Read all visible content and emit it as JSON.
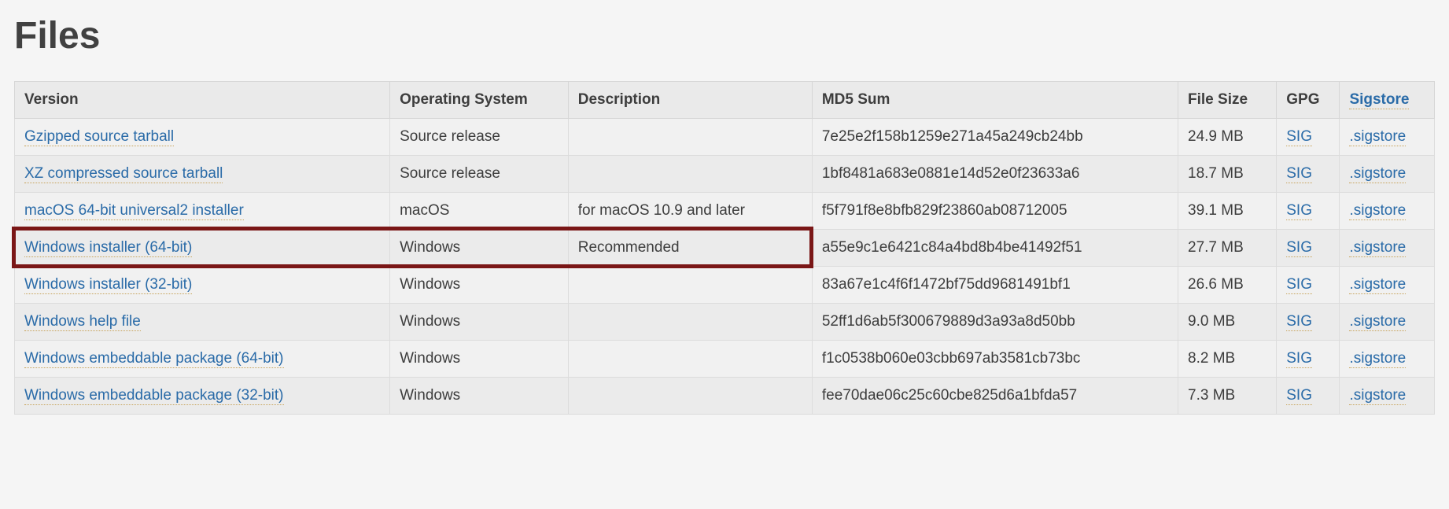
{
  "title": "Files",
  "headers": {
    "version": "Version",
    "os": "Operating System",
    "description": "Description",
    "md5": "MD5 Sum",
    "size": "File Size",
    "gpg": "GPG",
    "sigstore": "Sigstore"
  },
  "rows": [
    {
      "version": "Gzipped source tarball",
      "os": "Source release",
      "description": "",
      "md5": "7e25e2f158b1259e271a45a249cb24bb",
      "size": "24.9 MB",
      "gpg": "SIG",
      "sigstore": ".sigstore",
      "highlight": false
    },
    {
      "version": "XZ compressed source tarball",
      "os": "Source release",
      "description": "",
      "md5": "1bf8481a683e0881e14d52e0f23633a6",
      "size": "18.7 MB",
      "gpg": "SIG",
      "sigstore": ".sigstore",
      "highlight": false
    },
    {
      "version": "macOS 64-bit universal2 installer",
      "os": "macOS",
      "description": "for macOS 10.9 and later",
      "md5": "f5f791f8e8bfb829f23860ab08712005",
      "size": "39.1 MB",
      "gpg": "SIG",
      "sigstore": ".sigstore",
      "highlight": false
    },
    {
      "version": "Windows installer (64-bit)",
      "os": "Windows",
      "description": "Recommended",
      "md5": "a55e9c1e6421c84a4bd8b4be41492f51",
      "size": "27.7 MB",
      "gpg": "SIG",
      "sigstore": ".sigstore",
      "highlight": true
    },
    {
      "version": "Windows installer (32-bit)",
      "os": "Windows",
      "description": "",
      "md5": "83a67e1c4f6f1472bf75dd9681491bf1",
      "size": "26.6 MB",
      "gpg": "SIG",
      "sigstore": ".sigstore",
      "highlight": false
    },
    {
      "version": "Windows help file",
      "os": "Windows",
      "description": "",
      "md5": "52ff1d6ab5f300679889d3a93a8d50bb",
      "size": "9.0 MB",
      "gpg": "SIG",
      "sigstore": ".sigstore",
      "highlight": false
    },
    {
      "version": "Windows embeddable package (64-bit)",
      "os": "Windows",
      "description": "",
      "md5": "f1c0538b060e03cbb697ab3581cb73bc",
      "size": "8.2 MB",
      "gpg": "SIG",
      "sigstore": ".sigstore",
      "highlight": false
    },
    {
      "version": "Windows embeddable package (32-bit)",
      "os": "Windows",
      "description": "",
      "md5": "fee70dae06c25c60cbe825d6a1bfda57",
      "size": "7.3 MB",
      "gpg": "SIG",
      "sigstore": ".sigstore",
      "highlight": false
    }
  ]
}
